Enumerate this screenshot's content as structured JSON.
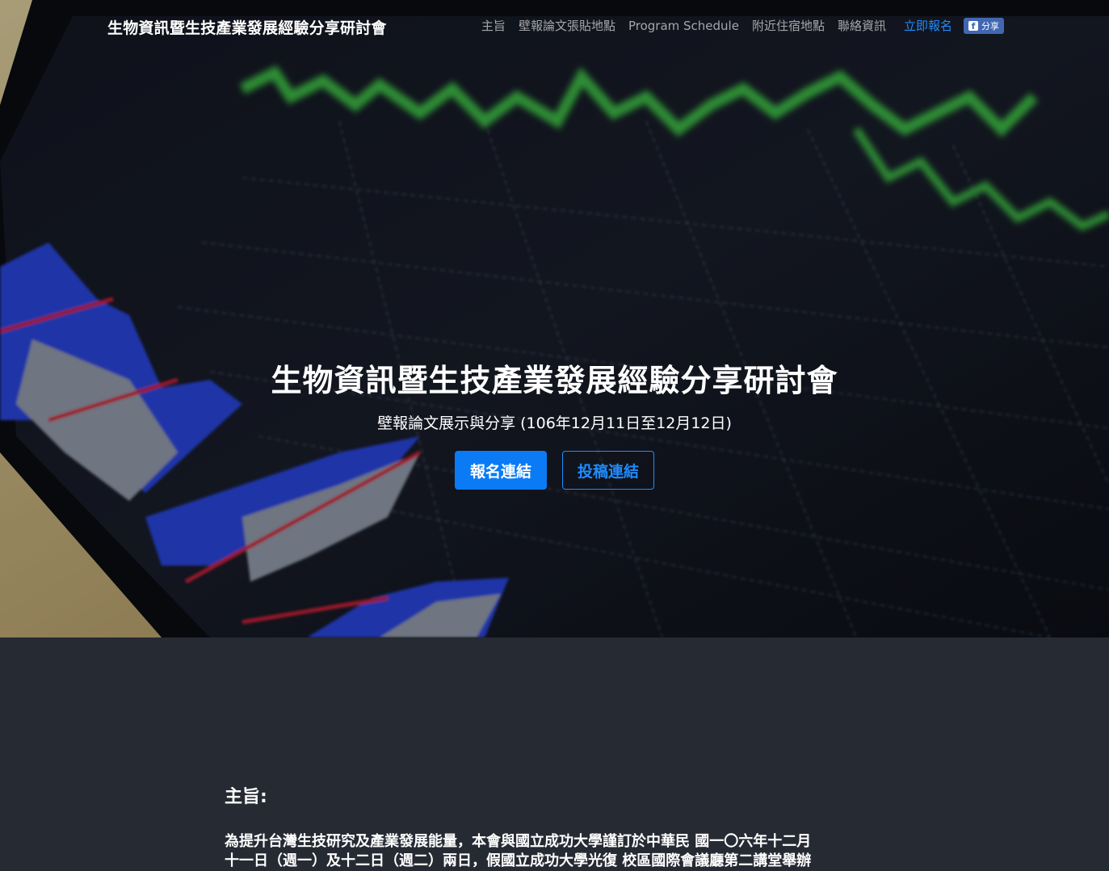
{
  "navbar": {
    "brand": "生物資訊暨生技產業發展經驗分享研討會",
    "links": [
      "主旨",
      "壁報論文張貼地點",
      "Program Schedule",
      "附近住宿地點",
      "聯絡資訊"
    ],
    "register_label": "立即報名",
    "share_label": "分享",
    "share_icon": "facebook-icon",
    "accent_color": "#1f8cff"
  },
  "hero": {
    "title": "生物資訊暨生技產業發展經驗分享研討會",
    "subtitle": "壁報論文展示與分享 (106年12月11日至12月12日)",
    "primary_button": "報名連結",
    "secondary_button": "投稿連結",
    "primary_color": "#0a7bf5"
  },
  "purpose": {
    "heading": "主旨:",
    "line1": "為提升台灣生技研究及產業發展能量，本會與國立成功大學謹訂於中華民 國一〇六年十二月",
    "line2": "十一日（週一）及十二日（週二）兩日，假國立成功大學光復 校區國際會議廳第二講堂舉辦"
  },
  "page_background": "#262a33"
}
